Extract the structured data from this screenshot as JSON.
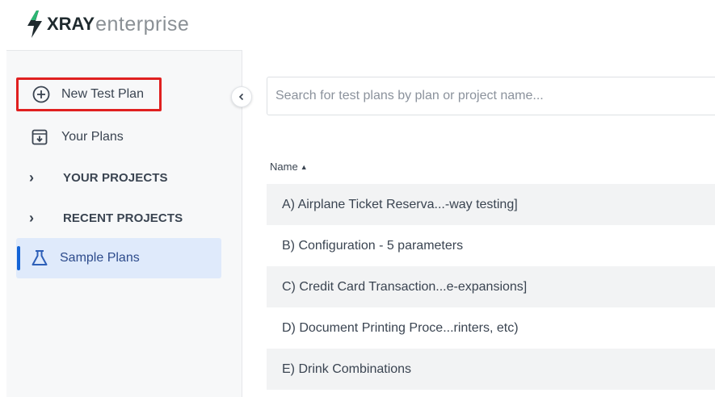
{
  "header": {
    "logo_brand": "XRAY",
    "logo_suffix": "enterprise"
  },
  "sidebar": {
    "new_test_plan": "New Test Plan",
    "your_plans": "Your Plans",
    "your_projects": "YOUR PROJECTS",
    "recent_projects": "RECENT PROJECTS",
    "sample_plans": "Sample Plans"
  },
  "main": {
    "search_placeholder": "Search for test plans by plan or project name...",
    "name_column": "Name",
    "plans": [
      "A) Airplane Ticket Reserva...-way testing]",
      "B) Configuration - 5 parameters",
      "C) Credit Card Transaction...e-expansions]",
      "D) Document Printing Proce...rinters, etc)",
      "E) Drink Combinations"
    ]
  },
  "colors": {
    "highlight_border": "#e02020",
    "active_bg": "#dfeafb",
    "active_bar": "#1464d6",
    "logo_green": "#2bb673"
  }
}
